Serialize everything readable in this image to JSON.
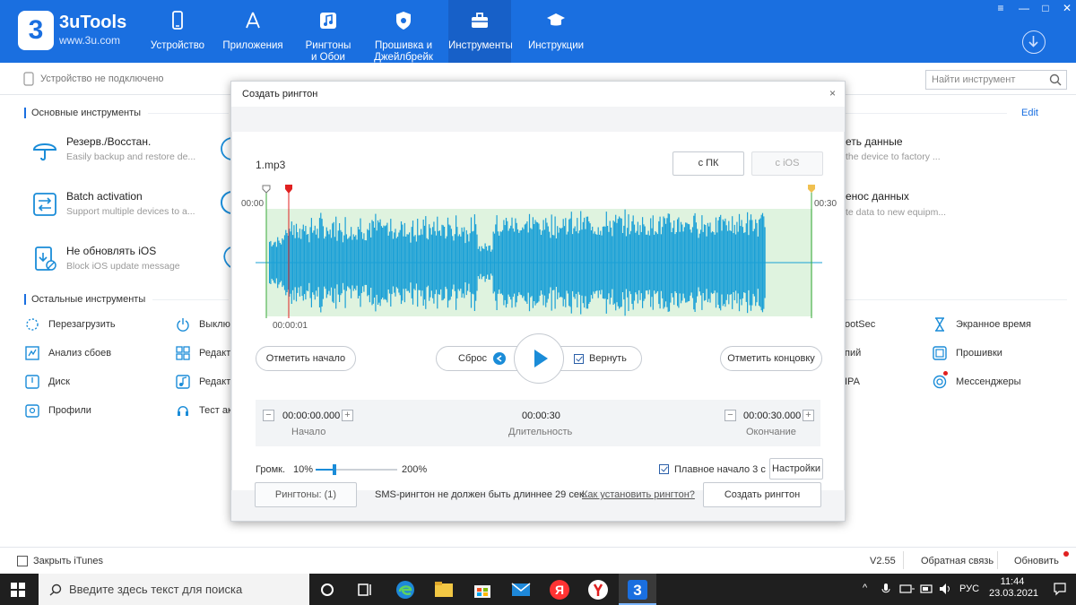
{
  "app": {
    "brand": "3uTools",
    "url": "www.3u.com",
    "logo_char": "3"
  },
  "nav": [
    {
      "label": "Устройство",
      "icon": "phone-icon"
    },
    {
      "label": "Приложения",
      "icon": "appstore-icon"
    },
    {
      "label": "Рингтоны\nи Обои",
      "icon": "music-icon"
    },
    {
      "label": "Прошивка и\nДжейлбрейк",
      "icon": "firmware-icon"
    },
    {
      "label": "Инструменты",
      "icon": "toolbox-icon",
      "active": true
    },
    {
      "label": "Инструкции",
      "icon": "graduation-cap-icon"
    }
  ],
  "window_controls": {
    "menu": "≡",
    "minimize": "—",
    "maximize": "□",
    "close": "✕"
  },
  "subheader": {
    "status": "Устройство не подключено",
    "search_placeholder": "Найти инструмент"
  },
  "main_tools": {
    "title": "Основные инструменты",
    "edit": "Edit",
    "left": [
      {
        "title": "Резерв./Восстан.",
        "subtitle": "Easily backup and restore de...",
        "icon": "umbrella-icon"
      },
      {
        "title": "Batch activation",
        "subtitle": "Support multiple devices to a...",
        "icon": "batch-activation-icon"
      },
      {
        "title": "Не обновлять iOS",
        "subtitle": "Block iOS update message",
        "icon": "block-update-icon"
      }
    ],
    "right_partial": [
      {
        "title": "еть данные",
        "subtitle": "the device to factory ..."
      },
      {
        "title": "енос данных",
        "subtitle": "te data to new equipm..."
      }
    ]
  },
  "other_tools": {
    "title": "Остальные инструменты",
    "col1": [
      {
        "label": "Перезагрузить",
        "icon": "restart-icon"
      },
      {
        "label": "Анализ сбоев",
        "icon": "crash-analysis-icon"
      },
      {
        "label": "Диск",
        "icon": "disk-icon"
      },
      {
        "label": "Профили",
        "icon": "profile-icon"
      }
    ],
    "col2": [
      {
        "label": "Выклю",
        "icon": "power-icon"
      },
      {
        "label": "Редакто",
        "icon": "grid-editor-icon"
      },
      {
        "label": "Редакто",
        "icon": "music-editor-icon"
      },
      {
        "label": "Тест ак",
        "icon": "earphone-icon"
      }
    ],
    "col3": [
      {
        "label": "ootSec"
      },
      {
        "label": "пий"
      },
      {
        "label": "IPA"
      }
    ],
    "col4": [
      {
        "label": "Экранное время",
        "icon": "hourglass-icon"
      },
      {
        "label": "Прошивки",
        "icon": "firmware-file-icon"
      },
      {
        "label": "Мессенджеры",
        "icon": "messenger-icon"
      }
    ]
  },
  "footer": {
    "itunes_label": "Закрыть iTunes",
    "version": "V2.55",
    "feedback": "Обратная связь",
    "update": "Обновить"
  },
  "taskbar": {
    "search_placeholder": "Введите здесь текст для поиска",
    "lang": "РУС",
    "time": "11:44",
    "date": "23.03.2021"
  },
  "modal": {
    "title": "Создать рингтон",
    "close": "×",
    "file_name": "1.mp3",
    "from_pc": "с ПК",
    "from_ios": "с iOS",
    "time_start_label": "00:00",
    "time_end_label": "00:30",
    "cursor_label": "00:00:01",
    "mark_start": "Отметить начало",
    "mark_end": "Отметить концовку",
    "reset": "Сброс",
    "return_label": "Вернуть",
    "return_checked": true,
    "start_value": "00:00:00.000",
    "start_caption": "Начало",
    "duration_value": "00:00:30",
    "duration_caption": "Длительность",
    "end_value": "00:00:30.000",
    "end_caption": "Окончание",
    "volume_label": "Громк.",
    "volume_min": "10%",
    "volume_max": "200%",
    "volume_level": 0.23,
    "fade_label": "Плавное начало 3 с",
    "fade_checked": true,
    "settings": "Настройки",
    "ringtones_btn": "Рингтоны: (1)",
    "sms_note": "SMS-рингтон не должен быть длиннее 29 сек.",
    "how_to_link": "Как установить рингтон?",
    "create_btn": "Создать рингтон"
  },
  "colors": {
    "header_blue": "#1a6fe0",
    "accent": "#1a8cd8",
    "wave": "#1aa0d6",
    "wave_bg": "#dff3df",
    "start_marker": "#e02020",
    "end_marker": "#f0c050",
    "green_line": "#3aaa3a"
  }
}
